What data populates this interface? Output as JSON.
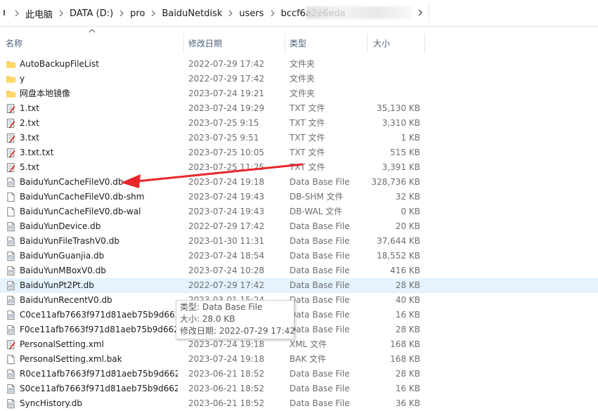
{
  "address_bar": {
    "crumbs": [
      "此电脑",
      "DATA (D:)",
      "pro",
      "BaiduNetdisk",
      "users",
      "bccf6a2e6eda"
    ]
  },
  "columns": {
    "name": "名称",
    "modified": "修改日期",
    "type": "类型",
    "size": "大小"
  },
  "files": [
    {
      "name": "AutoBackupFileList",
      "modified": "2022-07-29 17:42",
      "type": "文件夹",
      "size": "",
      "icon": "folder-icon"
    },
    {
      "name": "y",
      "modified": "2022-07-29 17:42",
      "type": "文件夹",
      "size": "",
      "icon": "folder-icon"
    },
    {
      "name": "网盘本地镜像",
      "modified": "2023-07-24 19:21",
      "type": "文件夹",
      "size": "",
      "icon": "folder-icon"
    },
    {
      "name": "1.txt",
      "modified": "2023-07-24 19:29",
      "type": "TXT 文件",
      "size": "35,130 KB",
      "icon": "text-file-icon"
    },
    {
      "name": "2.txt",
      "modified": "2023-07-25 9:15",
      "type": "TXT 文件",
      "size": "3,310 KB",
      "icon": "text-file-icon"
    },
    {
      "name": "3.txt",
      "modified": "2023-07-25 9:51",
      "type": "TXT 文件",
      "size": "1 KB",
      "icon": "text-file-icon"
    },
    {
      "name": "3.txt.txt",
      "modified": "2023-07-25 10:05",
      "type": "TXT 文件",
      "size": "515 KB",
      "icon": "text-file-icon"
    },
    {
      "name": "5.txt",
      "modified": "2023-07-25 11:25",
      "type": "TXT 文件",
      "size": "3,391 KB",
      "icon": "text-file-icon"
    },
    {
      "name": "BaiduYunCacheFileV0.db",
      "modified": "2023-07-24 19:18",
      "type": "Data Base File",
      "size": "328,736 KB",
      "icon": "db-file-icon"
    },
    {
      "name": "BaiduYunCacheFileV0.db-shm",
      "modified": "2023-07-24 19:43",
      "type": "DB-SHM 文件",
      "size": "32 KB",
      "icon": "blank-file-icon"
    },
    {
      "name": "BaiduYunCacheFileV0.db-wal",
      "modified": "2023-07-24 19:43",
      "type": "DB-WAL 文件",
      "size": "0 KB",
      "icon": "blank-file-icon"
    },
    {
      "name": "BaiduYunDevice.db",
      "modified": "2022-07-29 17:42",
      "type": "Data Base File",
      "size": "20 KB",
      "icon": "db-file-icon"
    },
    {
      "name": "BaiduYunFileTrashV0.db",
      "modified": "2023-01-30 11:31",
      "type": "Data Base File",
      "size": "37,644 KB",
      "icon": "db-file-icon"
    },
    {
      "name": "BaiduYunGuanjia.db",
      "modified": "2023-07-24 18:54",
      "type": "Data Base File",
      "size": "18,552 KB",
      "icon": "db-file-icon"
    },
    {
      "name": "BaiduYunMBoxV0.db",
      "modified": "2023-07-24 10:28",
      "type": "Data Base File",
      "size": "416 KB",
      "icon": "db-file-icon"
    },
    {
      "name": "BaiduYunPt2Pt.db",
      "modified": "2022-07-29 17:42",
      "type": "Data Base File",
      "size": "28 KB",
      "icon": "db-file-icon"
    },
    {
      "name": "BaiduYunRecentV0.db",
      "modified": "2023-03-01 15:24",
      "type": "Data Base File",
      "size": "40 KB",
      "icon": "db-file-icon"
    },
    {
      "name": "C0ce11afb7663f971d81aeb75b9d662...",
      "modified": "",
      "type": "Data Base File",
      "size": "16 KB",
      "icon": "db-file-icon"
    },
    {
      "name": "F0ce11afb7663f971d81aeb75b9d662...",
      "modified": "",
      "type": "Data Base File",
      "size": "28 KB",
      "icon": "db-file-icon"
    },
    {
      "name": "PersonalSetting.xml",
      "modified": "2023-07-24 19:18",
      "type": "XML 文件",
      "size": "168 KB",
      "icon": "xml-file-icon"
    },
    {
      "name": "PersonalSetting.xml.bak",
      "modified": "2023-07-24 19:18",
      "type": "BAK 文件",
      "size": "168 KB",
      "icon": "blank-file-icon"
    },
    {
      "name": "R0ce11afb7663f971d81aeb75b9d662...",
      "modified": "2023-06-21 18:52",
      "type": "Data Base File",
      "size": "28 KB",
      "icon": "db-file-icon"
    },
    {
      "name": "S0ce11afb7663f971d81aeb75b9d662...",
      "modified": "2023-06-21 18:52",
      "type": "Data Base File",
      "size": "16 KB",
      "icon": "db-file-icon"
    },
    {
      "name": "SyncHistory.db",
      "modified": "2023-06-21 18:52",
      "type": "Data Base File",
      "size": "36 KB",
      "icon": "db-file-icon"
    }
  ],
  "hovered_row": 15,
  "tooltip": {
    "type": "类型: Data Base File",
    "size": "大小: 28.0 KB",
    "modified": "修改日期: 2022-07-29 17:42"
  },
  "annotation": {
    "color": "#e8262a",
    "points_to_row": 8
  }
}
